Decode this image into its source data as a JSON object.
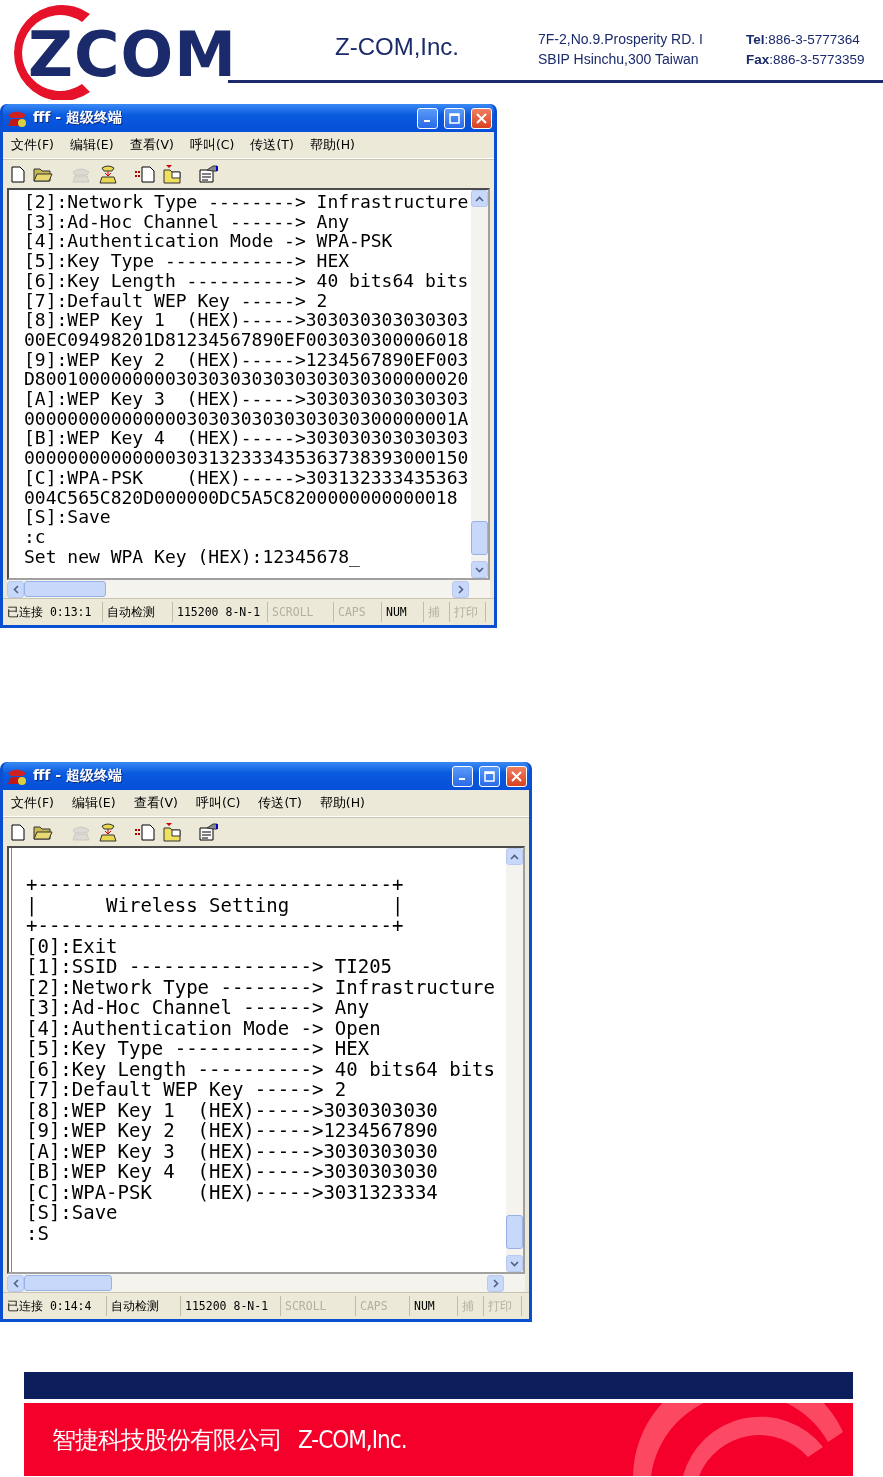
{
  "header": {
    "logo_text": "ZCOM",
    "company": "Z-COM,Inc.",
    "address_lines": [
      "7F-2,No.9.Prosperity RD. I",
      "SBIP Hsinchu,300 Taiwan"
    ],
    "contacts": [
      {
        "label": "Tel",
        "value": ":886-3-5777364"
      },
      {
        "label": "Fax",
        "value": ":886-3-5773359"
      }
    ]
  },
  "windows": [
    {
      "title": "fff - 超级终端",
      "menu": [
        "文件(F)",
        "编辑(E)",
        "查看(V)",
        "呼叫(C)",
        "传送(T)",
        "帮助(H)"
      ],
      "toolbar": [
        {
          "kind": "new",
          "disabled": false
        },
        {
          "kind": "open",
          "disabled": false
        },
        {
          "kind": "disconnect",
          "disabled": true
        },
        {
          "kind": "call",
          "disabled": false
        },
        {
          "kind": "send",
          "disabled": false
        },
        {
          "kind": "receive",
          "disabled": false
        },
        {
          "kind": "properties",
          "disabled": false
        }
      ],
      "terminal_lines": [
        "[2]:Network Type --------> Infrastructure",
        "[3]:Ad-Hoc Channel ------> Any",
        "[4]:Authentication Mode -> WPA-PSK",
        "[5]:Key Type ------------> HEX",
        "[6]:Key Length ----------> 40 bits64 bits",
        "[7]:Default WEP Key -----> 2",
        "[8]:WEP Key 1  (HEX)----->303030303030303",
        "00EC09498201D81234567890EF003030300006018",
        "[9]:WEP Key 2  (HEX)----->1234567890EF003",
        "D8001000000000303030303030303030300000020",
        "[A]:WEP Key 3  (HEX)----->303030303030303",
        "0000000000000003030303030303030300000001A",
        "[B]:WEP Key 4  (HEX)----->303030303030303",
        "00000000000000303132333435363738393000150",
        "[C]:WPA-PSK    (HEX)----->303132333435363",
        "004C565C820D000000DC5A5C8200000000000018",
        "[S]:Save",
        ":c",
        "Set new WPA Key (HEX):12345678_"
      ],
      "status": [
        {
          "text": "已连接 0:13:1",
          "disabled": false
        },
        {
          "text": "自动检测",
          "disabled": false
        },
        {
          "text": "115200 8-N-1",
          "disabled": false
        },
        {
          "text": "SCROLL",
          "disabled": true
        },
        {
          "text": "CAPS",
          "disabled": true
        },
        {
          "text": "NUM",
          "disabled": false
        },
        {
          "text": "捕",
          "disabled": true
        },
        {
          "text": "打印",
          "disabled": true
        }
      ]
    },
    {
      "title": "fff - 超级终端",
      "menu": [
        "文件(F)",
        "编辑(E)",
        "查看(V)",
        "呼叫(C)",
        "传送(T)",
        "帮助(H)"
      ],
      "toolbar": [
        {
          "kind": "new",
          "disabled": false
        },
        {
          "kind": "open",
          "disabled": false
        },
        {
          "kind": "disconnect",
          "disabled": true
        },
        {
          "kind": "call",
          "disabled": false
        },
        {
          "kind": "send",
          "disabled": false
        },
        {
          "kind": "receive",
          "disabled": false
        },
        {
          "kind": "properties",
          "disabled": false
        }
      ],
      "terminal_lines": [
        "+-------------------------------+",
        "|      Wireless Setting         |",
        "+-------------------------------+",
        "[0]:Exit",
        "[1]:SSID ----------------> TI205",
        "[2]:Network Type --------> Infrastructure",
        "[3]:Ad-Hoc Channel ------> Any",
        "[4]:Authentication Mode -> Open",
        "[5]:Key Type ------------> HEX",
        "[6]:Key Length ----------> 40 bits64 bits",
        "[7]:Default WEP Key -----> 2",
        "[8]:WEP Key 1  (HEX)----->3030303030",
        "[9]:WEP Key 2  (HEX)----->1234567890",
        "[A]:WEP Key 3  (HEX)----->3030303030",
        "[B]:WEP Key 4  (HEX)----->3030303030",
        "[C]:WPA-PSK    (HEX)----->3031323334",
        "[S]:Save",
        ":S"
      ],
      "status": [
        {
          "text": "已连接 0:14:4",
          "disabled": false
        },
        {
          "text": "自动检测",
          "disabled": false
        },
        {
          "text": "115200 8-N-1",
          "disabled": false
        },
        {
          "text": "SCROLL",
          "disabled": true
        },
        {
          "text": "CAPS",
          "disabled": true
        },
        {
          "text": "NUM",
          "disabled": false
        },
        {
          "text": "捕",
          "disabled": true
        },
        {
          "text": "打印",
          "disabled": true
        }
      ]
    }
  ],
  "footer": {
    "company_cn": "智捷科技股份有限公司",
    "company_en": "Z-COM,Inc."
  }
}
